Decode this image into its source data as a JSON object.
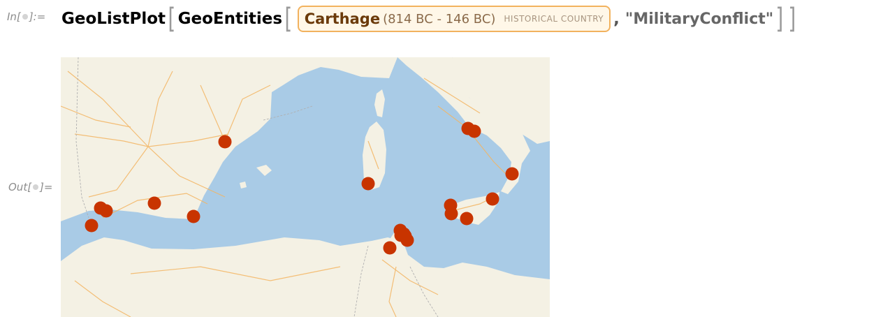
{
  "input_label": {
    "prefix": "In[",
    "suffix": "]:="
  },
  "output_label": {
    "prefix": "Out[",
    "suffix": "]="
  },
  "code": {
    "function_outer": "GeoListPlot",
    "function_inner": "GeoEntities",
    "entity_name": "Carthage",
    "entity_dates": "(814 BC - 146 BC)",
    "entity_type": "HISTORICAL COUNTRY",
    "comma": ",",
    "argument": "\"MilitaryConflict\""
  },
  "map": {
    "land_color": "#f4f1e4",
    "sea_color": "#a9cbe6",
    "road_color": "#f3b562",
    "point_color": "#c83400",
    "points_count": 20
  }
}
